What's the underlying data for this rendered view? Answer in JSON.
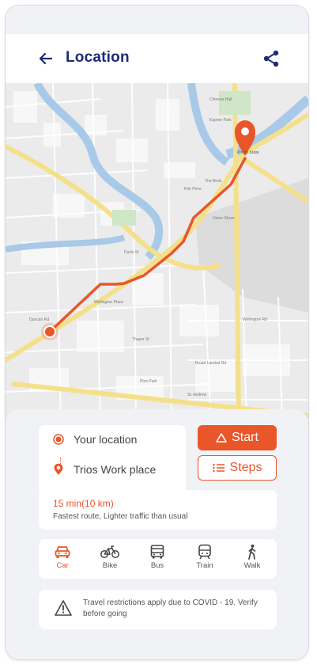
{
  "header": {
    "title": "Location",
    "back_icon": "arrow-left-icon",
    "share_icon": "share-icon"
  },
  "map": {
    "destination_label": "Prince Srate",
    "labels": [
      "Chinese Hall",
      "Kapner Park",
      "The Birds",
      "Pier Pens",
      "Union Shore",
      "Wellington Place",
      "Duncan Rd",
      "Thayer St",
      "Pine Park",
      "Broad Landed Rd",
      "St. Andrew",
      "Wellington Rd",
      "Davis St"
    ]
  },
  "route": {
    "origin": "Your location",
    "destination": "Trios Work place"
  },
  "actions": {
    "start_label": "Start",
    "steps_label": "Steps"
  },
  "eta": {
    "time": "15 min(10 km)",
    "description": "Fastest route, Lighter traffic than usual"
  },
  "modes": [
    {
      "label": "Car",
      "icon": "car-icon",
      "active": true
    },
    {
      "label": "Bike",
      "icon": "bike-icon",
      "active": false
    },
    {
      "label": "Bus",
      "icon": "bus-icon",
      "active": false
    },
    {
      "label": "Train",
      "icon": "train-icon",
      "active": false
    },
    {
      "label": "Walk",
      "icon": "walk-icon",
      "active": false
    }
  ],
  "notice": {
    "text": "Travel restrictions apply due to COVID - 19. Verify before going"
  },
  "colors": {
    "accent": "#e8562a",
    "title": "#1e2a78",
    "route": "#e8562a",
    "water": "#a9c9e8",
    "road_major": "#f5e08a"
  }
}
